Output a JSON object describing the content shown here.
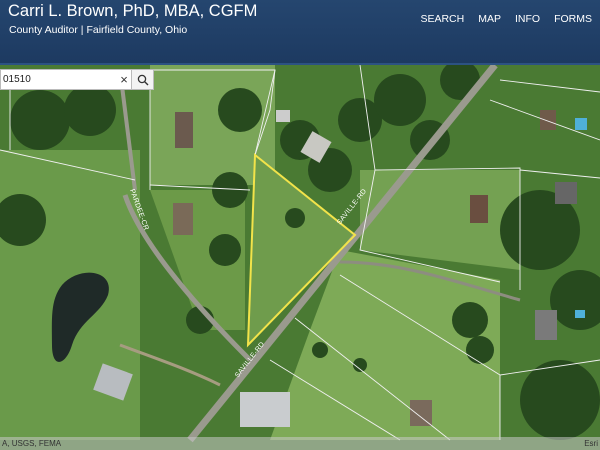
{
  "header": {
    "title": "Carri L. Brown, PhD, MBA, CGFM",
    "subtitle": "County Auditor | Fairfield County, Ohio"
  },
  "nav": [
    "SEARCH",
    "MAP",
    "INFO",
    "FORMS"
  ],
  "search": {
    "value": "01510",
    "clear_icon": "×"
  },
  "map": {
    "road_labels": [
      "PARDEE-CR",
      "SAVILLE-RD",
      "SAVILLE-RD"
    ],
    "selected_parcel_color": "#f2e34a"
  },
  "attribution": {
    "left": "A, USGS, FEMA",
    "right": "Esri"
  },
  "colors": {
    "header_bg": "#1d3a61",
    "parcel_line": "#ffffff",
    "highlight": "#f2e34a"
  }
}
